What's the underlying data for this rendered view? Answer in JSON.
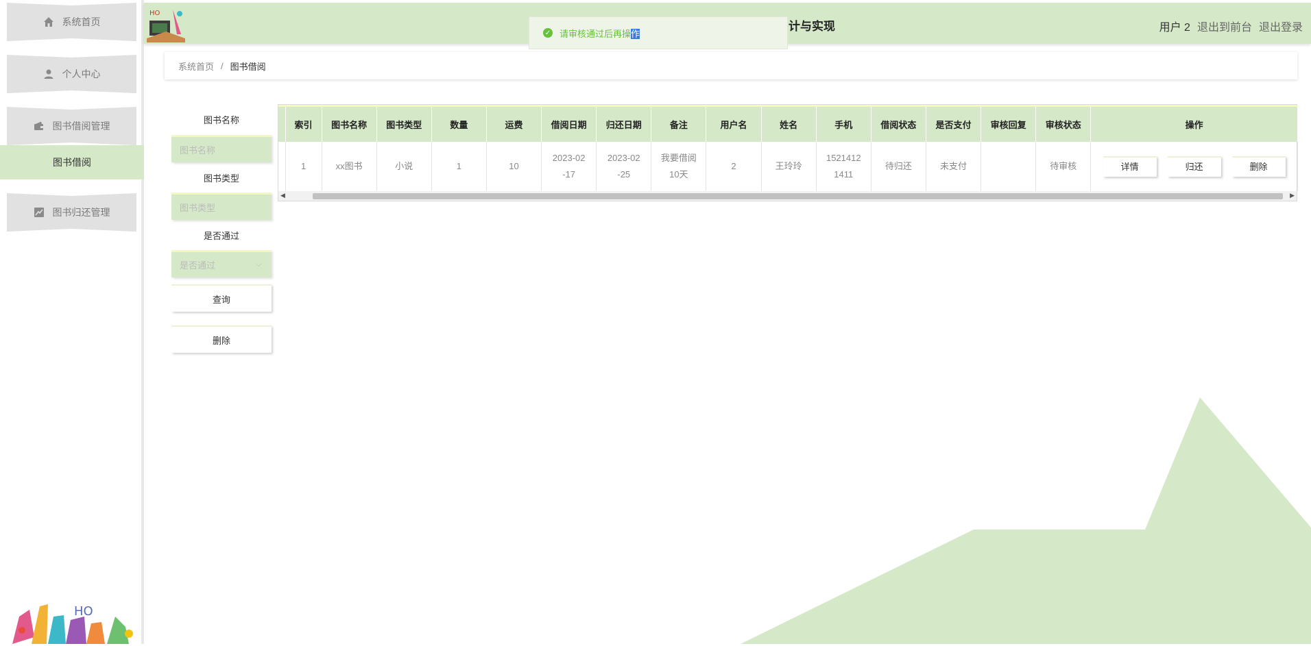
{
  "sidebar": {
    "items": [
      {
        "label": "系统首页",
        "icon": "home-icon"
      },
      {
        "label": "个人中心",
        "icon": "person-icon"
      },
      {
        "label": "图书借阅管理",
        "icon": "wallet-icon"
      },
      {
        "label": "图书借阅"
      },
      {
        "label": "图书归还管理",
        "icon": "chart-icon"
      }
    ]
  },
  "topbar": {
    "title": "计与实现",
    "user": "用户 2",
    "back_front": "退出到前台",
    "logout": "退出登录"
  },
  "toast": {
    "message_main": "请审核通过后再操",
    "message_highlight": "作"
  },
  "breadcrumb": {
    "home": "系统首页",
    "separator": "/",
    "current": "图书借阅"
  },
  "filters": {
    "book_name_label": "图书名称",
    "book_name_placeholder": "图书名称",
    "book_type_label": "图书类型",
    "book_type_placeholder": "图书类型",
    "passed_label": "是否通过",
    "passed_placeholder": "是否通过",
    "query_button": "查询",
    "delete_button": "删除"
  },
  "table": {
    "columns": [
      "索引",
      "图书名称",
      "图书类型",
      "数量",
      "运费",
      "借阅日期",
      "归还日期",
      "备注",
      "用户名",
      "姓名",
      "手机",
      "借阅状态",
      "是否支付",
      "审核回复",
      "审核状态",
      "操作"
    ],
    "rows": [
      {
        "index": "1",
        "book_name": "xx图书",
        "book_type": "小说",
        "quantity": "1",
        "freight": "10",
        "borrow_date_1": "2023-02",
        "borrow_date_2": "-17",
        "return_date_1": "2023-02",
        "return_date_2": "-25",
        "remark_1": "我要借阅",
        "remark_2": "10天",
        "username": "2",
        "name": "王玲玲",
        "phone_1": "1521412",
        "phone_2": "1411",
        "borrow_status": "待归还",
        "paid": "未支付",
        "review_reply": "",
        "review_status": "待审核",
        "actions": {
          "detail": "详情",
          "return": "归还",
          "delete": "删除"
        }
      }
    ]
  },
  "colors": {
    "accent": "#d5e9c8",
    "accent_border": "#f3f7c4",
    "toast_text": "#67c23a"
  }
}
